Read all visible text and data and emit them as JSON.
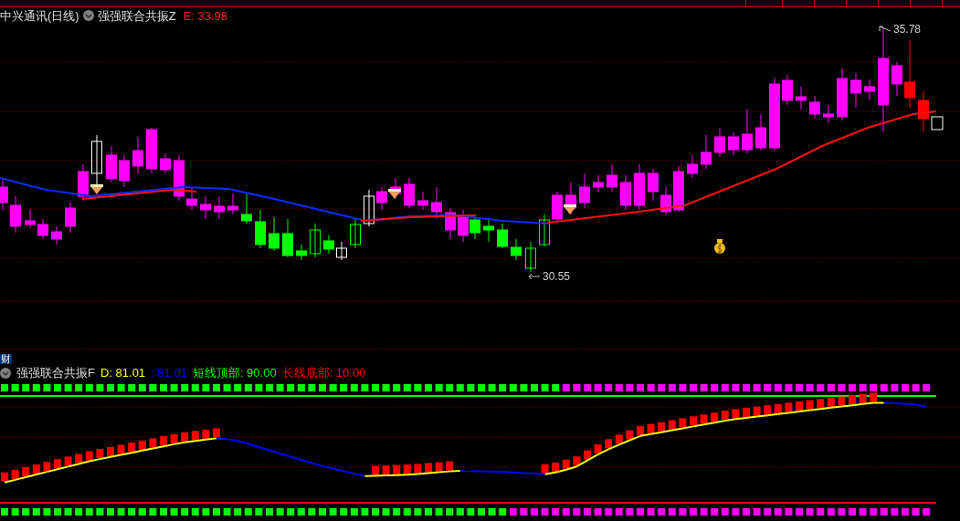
{
  "header": {
    "title": "中兴通讯(日线)",
    "indicator": "强强联合共振Z",
    "value": "E: 33.98"
  },
  "price_chart": {
    "high_label": "35.78",
    "low_label": "30.55"
  },
  "tag": "财",
  "indicator_panel": {
    "name": "强强联合共振F",
    "readings": [
      {
        "text": "D: 81.01",
        "color": "#ffff00"
      },
      {
        "text": ": 81.01",
        "color": "#0000ff"
      },
      {
        "text": "短线顶部: 90.00",
        "color": "#00ff00"
      },
      {
        "text": "长线底部: 10.00",
        "color": "#ff0000"
      }
    ]
  }
}
